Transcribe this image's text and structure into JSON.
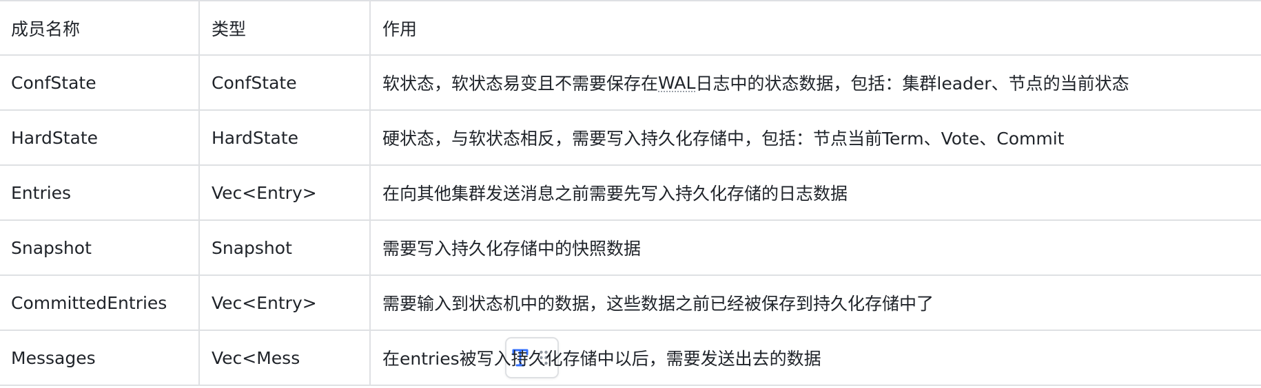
{
  "table": {
    "headers": [
      "成员名称",
      "类型",
      "作用"
    ],
    "rows": [
      {
        "name": "ConfState",
        "type": "ConfState",
        "desc_parts": [
          "软状态，软状态易变且不需要保存在",
          "WAL",
          "日志中的状态数据，包括：集群leader、节点的当前状态"
        ]
      },
      {
        "name": "HardState",
        "type": "HardState",
        "desc": "硬状态，与软状态相反，需要写入持久化存储中，包括：节点当前Term、Vote、Commit"
      },
      {
        "name": "Entries",
        "type": "Vec<Entry>",
        "desc": "在向其他集群发送消息之前需要先写入持久化存储的日志数据"
      },
      {
        "name": "Snapshot",
        "type": "Snapshot",
        "desc": "需要写入持久化存储中的快照数据"
      },
      {
        "name": "CommittedEntries",
        "type": "Vec<Entry>",
        "desc": "需要输入到状态机中的数据，这些数据之前已经被保存到持久化存储中了"
      },
      {
        "name": "Messages",
        "type": "Vec<Mess",
        "desc": "在entries被写入持久化存储中以后，需要发送出去的数据"
      }
    ]
  },
  "toolbox": {
    "text_style_icon": "text-style-icon",
    "drag_handle_icon": "drag-handle-icon",
    "accent": "#3370ff",
    "handle_color": "#8f959e"
  }
}
